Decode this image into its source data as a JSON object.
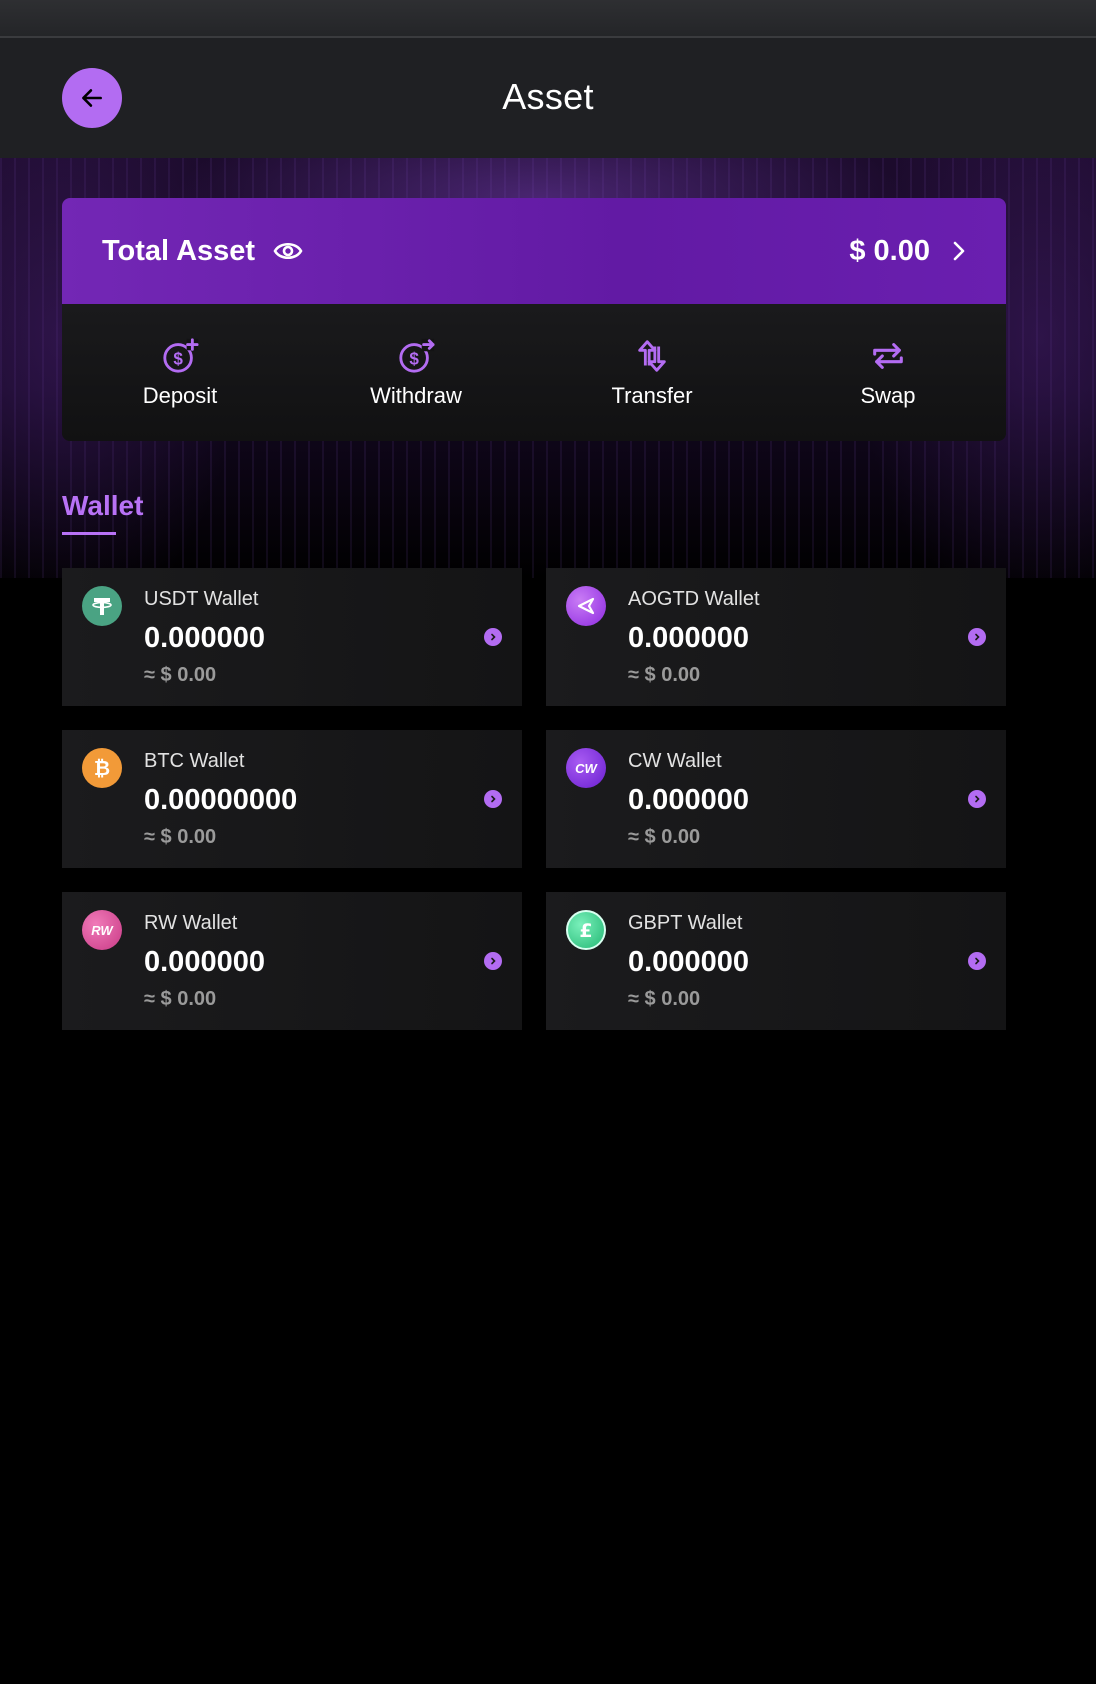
{
  "header": {
    "title": "Asset"
  },
  "total_asset": {
    "label": "Total Asset",
    "value": "$ 0.00"
  },
  "actions": [
    {
      "label": "Deposit",
      "icon": "deposit-icon"
    },
    {
      "label": "Withdraw",
      "icon": "withdraw-icon"
    },
    {
      "label": "Transfer",
      "icon": "transfer-icon"
    },
    {
      "label": "Swap",
      "icon": "swap-icon"
    }
  ],
  "wallet_tab": {
    "label": "Wallet"
  },
  "wallets": [
    {
      "name": "USDT Wallet",
      "amount": "0.000000",
      "fiat": "≈ $ 0.00",
      "icon": "usdt-icon"
    },
    {
      "name": "AOGTD Wallet",
      "amount": "0.000000",
      "fiat": "≈ $ 0.00",
      "icon": "aogtd-icon"
    },
    {
      "name": "BTC Wallet",
      "amount": "0.00000000",
      "fiat": "≈ $ 0.00",
      "icon": "btc-icon"
    },
    {
      "name": "CW Wallet",
      "amount": "0.000000",
      "fiat": "≈ $ 0.00",
      "icon": "cw-icon",
      "icon_text": "CW"
    },
    {
      "name": "RW Wallet",
      "amount": "0.000000",
      "fiat": "≈ $ 0.00",
      "icon": "rw-icon",
      "icon_text": "RW"
    },
    {
      "name": "GBPT Wallet",
      "amount": "0.000000",
      "fiat": "≈ $ 0.00",
      "icon": "gbpt-icon"
    }
  ],
  "colors": {
    "accent": "#b36cf2",
    "banner": "#6a1fb0",
    "usdt": "#4aa383",
    "aogtd": "#a541e8",
    "btc": "#f29a38",
    "cw": "#8a36e6",
    "rw": "#e0549a",
    "gbpt": "#3dd290"
  }
}
